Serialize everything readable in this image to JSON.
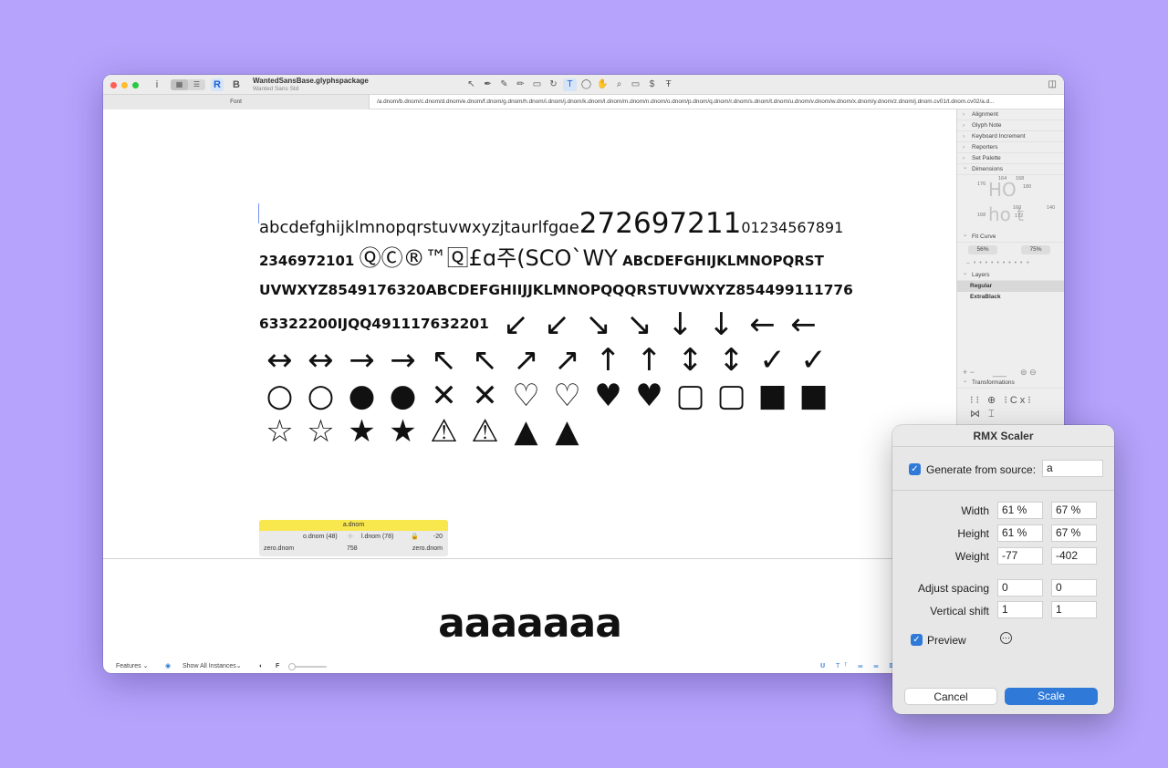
{
  "window": {
    "doc_title": "WantedSansBase.glyphspackage",
    "doc_subtitle": "Wanted Sans Std",
    "toolbar": {
      "info_icon": "i",
      "view_grid_icon": "▦",
      "view_list_icon": "☰",
      "regular_glyph": "R",
      "bold_glyph": "B",
      "tools": [
        "↖",
        "✒",
        "✎",
        "✏",
        "▭",
        "↻",
        "T",
        "◯",
        "✋",
        "⌕",
        "▭",
        "$",
        "Ŧ"
      ],
      "sidebar_toggle": "◫"
    },
    "tabs": {
      "font_tab": "Font",
      "text_tab": "/a.dnom/b.dnom/c.dnom/d.dnom/e.dnom/f.dnom/g.dnom/h.dnom/i.dnom/j.dnom/k.dnom/l.dnom/m.dnom/n.dnom/o.dnom/p.dnom/q.dnom/r.dnom/s.dnom/t.dnom/u.dnom/v.dnom/w.dnom/x.dnom/y.dnom/z.dnom/j.dnom.cv01/t.dnom.cv02/a.d..."
    },
    "canvas": {
      "line1a": "abcdefghijklmnopqrstuvwxyzjtaurlfgɑe",
      "line1b": "272697211",
      "line1c": "01234567891",
      "line2a": "2346972101",
      "line2b": "ⓆⒸ®™🅀£ɑ주(SCO",
      "line2c": "ˋWY",
      "line2d": "ABCDEFGHIJKLMNOPQRST",
      "line3": "UVWXYZ8549176320ABCDEFGHIIJJKLMNOPQQQRSTUVWXYZ854499111776",
      "line4": "63322200IJQQ491117632201",
      "row4_icons": [
        "↙",
        "↙",
        "↘",
        "↘",
        "↓",
        "↓",
        "←",
        "←"
      ],
      "row5_icons": [
        "↔",
        "↔",
        "→",
        "→",
        "↖",
        "↖",
        "↗",
        "↗",
        "↑",
        "↑",
        "↕",
        "↕",
        "✓",
        "✓"
      ],
      "row6_icons": [
        "○",
        "○",
        "●",
        "●",
        "✕",
        "✕",
        "♡",
        "♡",
        "♥",
        "♥",
        "▢",
        "▢",
        "■",
        "■"
      ],
      "row7_icons": [
        "☆",
        "☆",
        "★",
        "★",
        "⚠",
        "⚠",
        "▲",
        "▲"
      ],
      "info": {
        "glyph": "a.dnom",
        "left_kern": "o.dnom (48)",
        "right_kern": "l.dnom (78)",
        "kern_value": "-20",
        "left_group": "zero.dnom",
        "width": "758",
        "right_group": "zero.dnom"
      },
      "preview_text": "aaaaaaa",
      "bottom": {
        "features": "Features",
        "instances": "Show All Instances",
        "f_label": "F"
      }
    },
    "sidebar": {
      "sections": [
        "Alignment",
        "Glyph Note",
        "Keyboard Increment",
        "Reporters",
        "Set Palette"
      ],
      "dimensions": "Dimensions",
      "dims_values": [
        "176",
        "164",
        "168",
        "180",
        "168",
        "160",
        "172",
        "140"
      ],
      "dims_glyphs": [
        "HO",
        "ho t"
      ],
      "fit_curve": "Fit Curve",
      "fit_low": "56%",
      "fit_high": "75%",
      "layers": "Layers",
      "layer_items": [
        "Regular",
        "ExtraBlack"
      ],
      "transformations": "Transformations"
    }
  },
  "dialog": {
    "title": "RMX Scaler",
    "generate_label": "Generate from source:",
    "generate_value": "a",
    "generate_checked": true,
    "rows": [
      {
        "label": "Width",
        "v1": "61 %",
        "v2": "67 %"
      },
      {
        "label": "Height",
        "v1": "61 %",
        "v2": "67 %"
      },
      {
        "label": "Weight",
        "v1": "-77",
        "v2": "-402"
      },
      {
        "label": "Adjust spacing",
        "v1": "0",
        "v2": "0"
      },
      {
        "label": "Vertical shift",
        "v1": "1",
        "v2": "1"
      }
    ],
    "preview_label": "Preview",
    "preview_checked": true,
    "more_icon": "⋯",
    "cancel": "Cancel",
    "scale": "Scale"
  },
  "colors": {
    "background": "#b5a3fc",
    "accent": "#2f7ad8",
    "highlight": "#f9e74e"
  }
}
